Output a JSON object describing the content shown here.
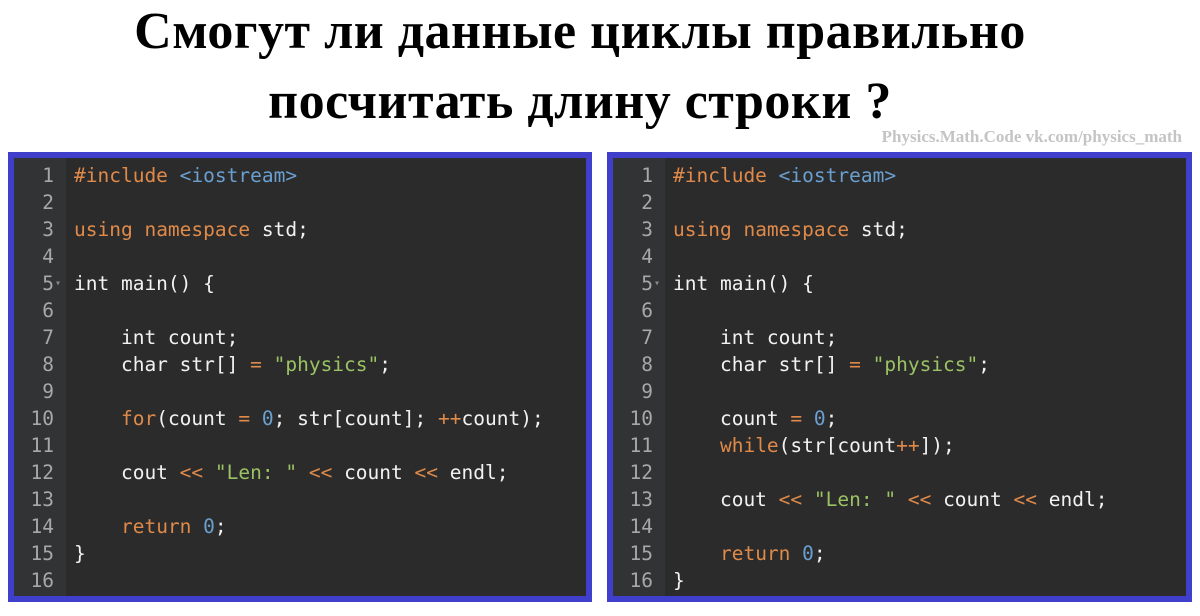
{
  "title": {
    "line1": "Смогут ли данные циклы правильно",
    "line2": "посчитать длину строки ?"
  },
  "watermark": "Physics.Math.Code vk.com/physics_math",
  "colors": {
    "panel_border": "#3f3fcc",
    "editor_bg": "#2b2b2b",
    "gutter_bg": "#313335",
    "keyword": "#e08a4a",
    "string": "#9bc264",
    "number": "#6a9fd0",
    "plain": "#f2f2f2",
    "line_number": "#a8a8a8"
  },
  "panels": [
    {
      "name": "for-loop-version",
      "lines": [
        {
          "n": "1",
          "tokens": [
            {
              "t": "#include",
              "c": "inc"
            },
            {
              "t": " ",
              "c": ""
            },
            {
              "t": "<iostream>",
              "c": "hdr"
            }
          ]
        },
        {
          "n": "2",
          "tokens": []
        },
        {
          "n": "3",
          "tokens": [
            {
              "t": "using",
              "c": "kw"
            },
            {
              "t": " ",
              "c": ""
            },
            {
              "t": "namespace",
              "c": "kw"
            },
            {
              "t": " std;",
              "c": ""
            }
          ]
        },
        {
          "n": "4",
          "tokens": []
        },
        {
          "n": "5",
          "fold": true,
          "tokens": [
            {
              "t": "int main() {",
              "c": ""
            }
          ]
        },
        {
          "n": "6",
          "tokens": []
        },
        {
          "n": "7",
          "tokens": [
            {
              "t": "    int count;",
              "c": ""
            }
          ]
        },
        {
          "n": "8",
          "tokens": [
            {
              "t": "    char str[] ",
              "c": ""
            },
            {
              "t": "=",
              "c": "op"
            },
            {
              "t": " ",
              "c": ""
            },
            {
              "t": "\"physics\"",
              "c": "str"
            },
            {
              "t": ";",
              "c": ""
            }
          ]
        },
        {
          "n": "9",
          "tokens": []
        },
        {
          "n": "10",
          "tokens": [
            {
              "t": "    ",
              "c": ""
            },
            {
              "t": "for",
              "c": "kw"
            },
            {
              "t": "(count ",
              "c": ""
            },
            {
              "t": "=",
              "c": "op"
            },
            {
              "t": " ",
              "c": ""
            },
            {
              "t": "0",
              "c": "num"
            },
            {
              "t": "; str[count]; ",
              "c": ""
            },
            {
              "t": "++",
              "c": "op"
            },
            {
              "t": "count);",
              "c": ""
            }
          ]
        },
        {
          "n": "11",
          "tokens": []
        },
        {
          "n": "12",
          "tokens": [
            {
              "t": "    cout ",
              "c": ""
            },
            {
              "t": "<<",
              "c": "op"
            },
            {
              "t": " ",
              "c": ""
            },
            {
              "t": "\"Len: \"",
              "c": "str"
            },
            {
              "t": " ",
              "c": ""
            },
            {
              "t": "<<",
              "c": "op"
            },
            {
              "t": " count ",
              "c": ""
            },
            {
              "t": "<<",
              "c": "op"
            },
            {
              "t": " endl;",
              "c": ""
            }
          ]
        },
        {
          "n": "13",
          "tokens": []
        },
        {
          "n": "14",
          "tokens": [
            {
              "t": "    ",
              "c": ""
            },
            {
              "t": "return",
              "c": "kw"
            },
            {
              "t": " ",
              "c": ""
            },
            {
              "t": "0",
              "c": "num"
            },
            {
              "t": ";",
              "c": ""
            }
          ]
        },
        {
          "n": "15",
          "tokens": [
            {
              "t": "}",
              "c": ""
            }
          ]
        },
        {
          "n": "16",
          "tokens": []
        }
      ]
    },
    {
      "name": "while-loop-version",
      "lines": [
        {
          "n": "1",
          "tokens": [
            {
              "t": "#include",
              "c": "inc"
            },
            {
              "t": " ",
              "c": ""
            },
            {
              "t": "<iostream>",
              "c": "hdr"
            }
          ]
        },
        {
          "n": "2",
          "tokens": []
        },
        {
          "n": "3",
          "tokens": [
            {
              "t": "using",
              "c": "kw"
            },
            {
              "t": " ",
              "c": ""
            },
            {
              "t": "namespace",
              "c": "kw"
            },
            {
              "t": " std;",
              "c": ""
            }
          ]
        },
        {
          "n": "4",
          "tokens": []
        },
        {
          "n": "5",
          "fold": true,
          "tokens": [
            {
              "t": "int main() {",
              "c": ""
            }
          ]
        },
        {
          "n": "6",
          "tokens": []
        },
        {
          "n": "7",
          "tokens": [
            {
              "t": "    int count;",
              "c": ""
            }
          ]
        },
        {
          "n": "8",
          "tokens": [
            {
              "t": "    char str[] ",
              "c": ""
            },
            {
              "t": "=",
              "c": "op"
            },
            {
              "t": " ",
              "c": ""
            },
            {
              "t": "\"physics\"",
              "c": "str"
            },
            {
              "t": ";",
              "c": ""
            }
          ]
        },
        {
          "n": "9",
          "tokens": []
        },
        {
          "n": "10",
          "tokens": [
            {
              "t": "    count ",
              "c": ""
            },
            {
              "t": "=",
              "c": "op"
            },
            {
              "t": " ",
              "c": ""
            },
            {
              "t": "0",
              "c": "num"
            },
            {
              "t": ";",
              "c": ""
            }
          ]
        },
        {
          "n": "11",
          "tokens": [
            {
              "t": "    ",
              "c": ""
            },
            {
              "t": "while",
              "c": "kw"
            },
            {
              "t": "(str[count",
              "c": ""
            },
            {
              "t": "++",
              "c": "op"
            },
            {
              "t": "]);",
              "c": ""
            }
          ]
        },
        {
          "n": "12",
          "tokens": []
        },
        {
          "n": "13",
          "tokens": [
            {
              "t": "    cout ",
              "c": ""
            },
            {
              "t": "<<",
              "c": "op"
            },
            {
              "t": " ",
              "c": ""
            },
            {
              "t": "\"Len: \"",
              "c": "str"
            },
            {
              "t": " ",
              "c": ""
            },
            {
              "t": "<<",
              "c": "op"
            },
            {
              "t": " count ",
              "c": ""
            },
            {
              "t": "<<",
              "c": "op"
            },
            {
              "t": " endl;",
              "c": ""
            }
          ]
        },
        {
          "n": "14",
          "tokens": []
        },
        {
          "n": "15",
          "tokens": [
            {
              "t": "    ",
              "c": ""
            },
            {
              "t": "return",
              "c": "kw"
            },
            {
              "t": " ",
              "c": ""
            },
            {
              "t": "0",
              "c": "num"
            },
            {
              "t": ";",
              "c": ""
            }
          ]
        },
        {
          "n": "16",
          "tokens": [
            {
              "t": "}",
              "c": ""
            }
          ]
        }
      ]
    }
  ]
}
